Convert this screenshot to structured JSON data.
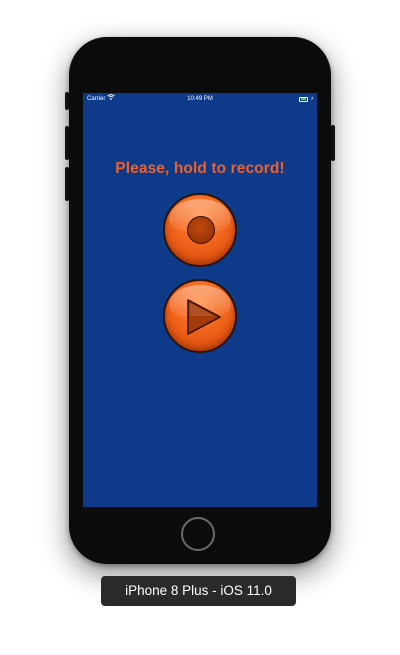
{
  "status_bar": {
    "carrier": "Carrier",
    "time": "10:49 PM",
    "icons": [
      "wifi-icon",
      "battery-icon",
      "charging-bolt-icon"
    ]
  },
  "main": {
    "title": "Please, hold to record!",
    "record_button_icon": "record-icon",
    "play_button_icon": "play-icon"
  },
  "device": {
    "label": "iPhone 8 Plus - iOS 11.0"
  },
  "colors": {
    "screen_background": "#0d3b8a",
    "accent_orange": "#f0602a",
    "phone_body": "#0b0b0b"
  }
}
